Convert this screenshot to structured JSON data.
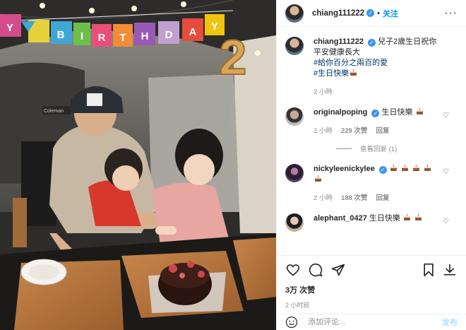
{
  "photo": {
    "banner_letters": [
      "Y",
      "B",
      "I",
      "R",
      "T",
      "H",
      "D",
      "A",
      "Y"
    ],
    "balloon_number": "2",
    "camp_brand": "Coleman"
  },
  "header": {
    "username": "chiang111222",
    "separator": "•",
    "follow_label": "关注",
    "more_label": "···"
  },
  "caption": {
    "username": "chiang111222",
    "text": "兒子2歲生日祝你平安健康長大",
    "hashtag1": "#給你百分之兩百的愛",
    "hashtag2": "#生日快樂",
    "time": "2 小時"
  },
  "comments": [
    {
      "username": "originalpoping",
      "text": "生日快樂",
      "cakes": 1,
      "time": "2 小時",
      "likes": "229 次赞",
      "reply": "回复"
    },
    {
      "username": "nickyleenickylee",
      "text": "",
      "cakes": 5,
      "time": "2 小時",
      "likes": "188 次赞",
      "reply": "回复"
    },
    {
      "username": "alephant_0427",
      "text": "生日快樂",
      "cakes": 2,
      "time": "",
      "likes": "",
      "reply": ""
    }
  ],
  "view_replies": "查看回复 (1)",
  "actions": {
    "likes": "3万 次赞",
    "time": "2 小时前",
    "icons": [
      "heart-icon",
      "comment-icon",
      "share-icon",
      "save-icon",
      "download-icon"
    ]
  },
  "add_comment": {
    "placeholder": "添加评论...",
    "post_label": "发布"
  },
  "colors": {
    "link": "#0095f6",
    "verified": "#3897f0",
    "hashtag": "#00376b",
    "muted": "#8e8e8e"
  }
}
